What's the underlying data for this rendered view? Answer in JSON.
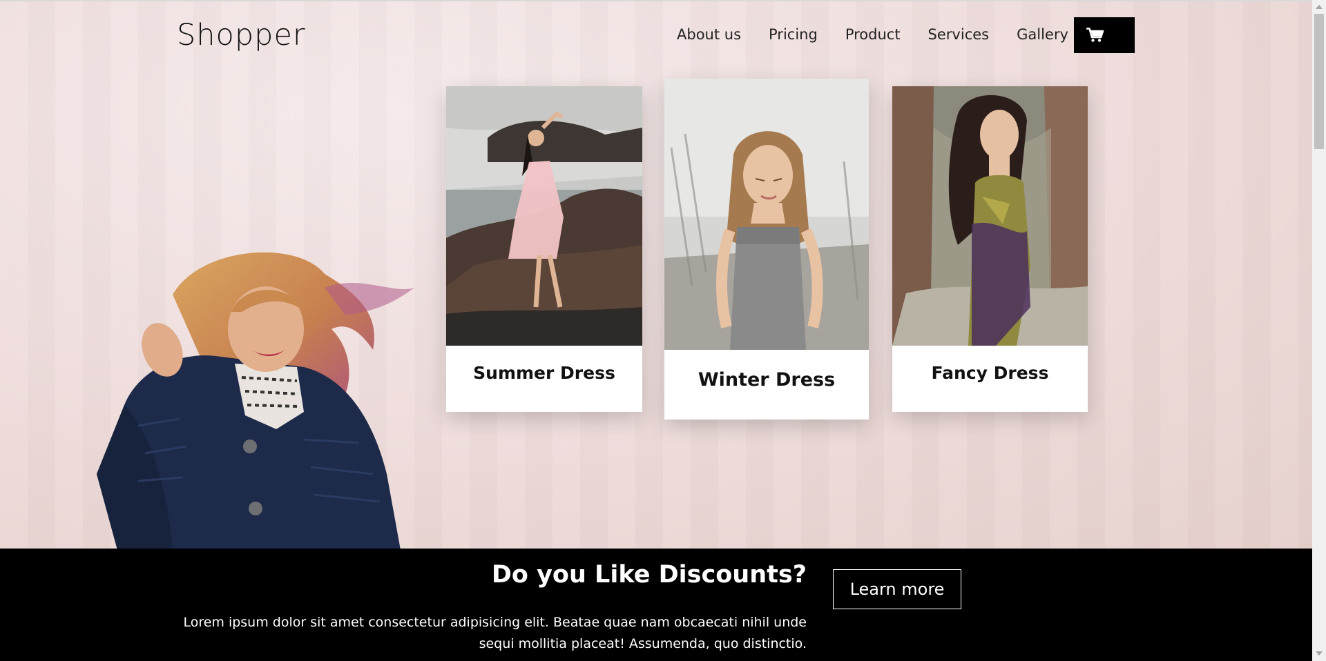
{
  "header": {
    "logo": "Shopper",
    "nav": [
      "About us",
      "Pricing",
      "Product",
      "Services",
      "Gallery"
    ],
    "cart_icon": "shopping-cart-icon"
  },
  "products": [
    {
      "title": "Summer Dress"
    },
    {
      "title": "Winter Dress"
    },
    {
      "title": "Fancy Dress"
    }
  ],
  "promo": {
    "title": "Do you Like Discounts?",
    "text": "Lorem ipsum dolor sit amet consectetur adipisicing elit. Beatae quae nam obcaecati nihil unde sequi mollitia placeat! Assumenda, quo distinctio.",
    "button": "Learn more"
  },
  "colors": {
    "promo_bg": "#000000",
    "cart_bg": "#000000",
    "hero_bg": "#efdedd"
  }
}
